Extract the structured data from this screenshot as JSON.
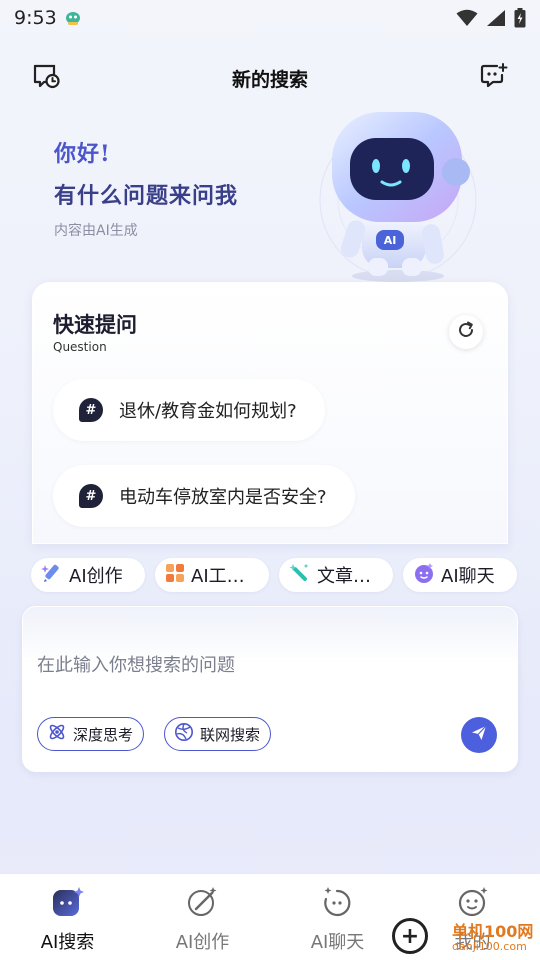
{
  "status_bar": {
    "time": "9:53"
  },
  "header": {
    "title": "新的搜索"
  },
  "greeting": {
    "line1": "你好!",
    "line2": "有什么问题来问我",
    "note": "内容由AI生成",
    "robot_badge": "AI"
  },
  "quick": {
    "title": "快速提问",
    "subtitle": "Question",
    "hash_symbol": "#",
    "questions": [
      "退休/教育金如何规划?",
      "电动车停放室内是否安全?"
    ]
  },
  "tools": [
    {
      "label": "AI创作",
      "icon": "pen-sparkle-icon"
    },
    {
      "label": "AI工具...",
      "icon": "grid-tools-icon"
    },
    {
      "label": "文章改...",
      "icon": "magic-wand-icon"
    },
    {
      "label": "AI聊天",
      "icon": "chat-face-icon"
    }
  ],
  "input": {
    "placeholder": "在此输入你想搜索的问题",
    "options": [
      "深度思考",
      "联网搜索"
    ]
  },
  "bottom_nav": [
    {
      "label": "AI搜索",
      "icon": "ai-search-icon",
      "active": true
    },
    {
      "label": "AI创作",
      "icon": "ai-create-icon",
      "active": false
    },
    {
      "label": "AI聊天",
      "icon": "ai-chat-icon",
      "active": false
    },
    {
      "label": "我的",
      "icon": "profile-face-icon",
      "active": false
    }
  ],
  "watermark": {
    "text": "单机100网",
    "sub": "danji100.com",
    "circle_glyph": "+"
  },
  "colors": {
    "accent": "#4c56cf",
    "send_button": "#4c5fdc",
    "greeting": "#4d56c9"
  }
}
